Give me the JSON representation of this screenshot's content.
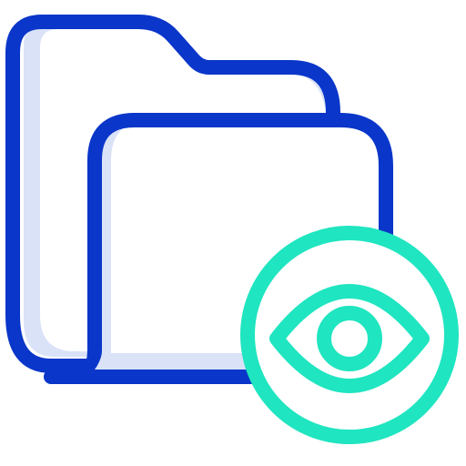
{
  "icon": {
    "name": "folder-view-icon",
    "colors": {
      "outline": "#0A36C9",
      "shadow": "#D9E2F7",
      "accent": "#1FE5C0",
      "fill": "#FFFFFF"
    },
    "parts": [
      "back-folder-icon",
      "front-folder-icon",
      "eye-badge-icon"
    ]
  }
}
